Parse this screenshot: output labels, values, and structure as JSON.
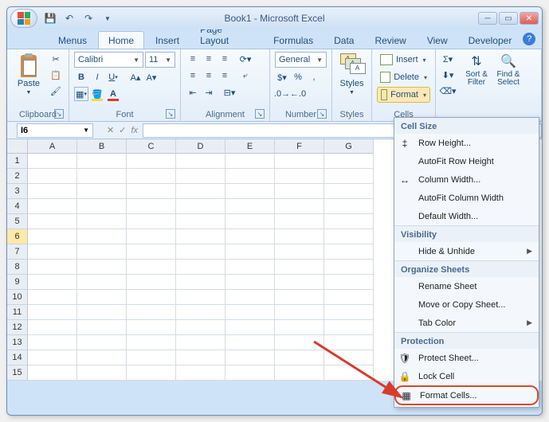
{
  "title": "Book1 - Microsoft Excel",
  "tabs": [
    "Menus",
    "Home",
    "Insert",
    "Page Layout",
    "Formulas",
    "Data",
    "Review",
    "View",
    "Developer"
  ],
  "active_tab": 1,
  "clipboard": {
    "label": "Clipboard",
    "paste": "Paste"
  },
  "font": {
    "label": "Font",
    "name": "Calibri",
    "size": "11"
  },
  "alignment": {
    "label": "Alignment"
  },
  "number": {
    "label": "Number",
    "format": "General"
  },
  "styles": {
    "label": "Styles"
  },
  "cells": {
    "label": "Cells",
    "insert": "Insert",
    "delete": "Delete",
    "format": "Format"
  },
  "editing": {
    "label": "",
    "sort": "Sort & Filter",
    "find": "Find & Select"
  },
  "namebox": "I6",
  "cols": [
    "A",
    "B",
    "C",
    "D",
    "E",
    "F",
    "G"
  ],
  "rows": [
    "1",
    "2",
    "3",
    "4",
    "5",
    "6",
    "7",
    "8",
    "9",
    "10",
    "11",
    "12",
    "13",
    "14",
    "15"
  ],
  "selected_row": 6,
  "menu": {
    "s1": "Cell Size",
    "row_h": "Row Height...",
    "autofit_row": "AutoFit Row Height",
    "col_w": "Column Width...",
    "autofit_col": "AutoFit Column Width",
    "default_w": "Default Width...",
    "s2": "Visibility",
    "hide": "Hide & Unhide",
    "s3": "Organize Sheets",
    "rename": "Rename Sheet",
    "move": "Move or Copy Sheet...",
    "tabcolor": "Tab Color",
    "s4": "Protection",
    "protect": "Protect Sheet...",
    "lock": "Lock Cell",
    "format_cells": "Format Cells..."
  }
}
